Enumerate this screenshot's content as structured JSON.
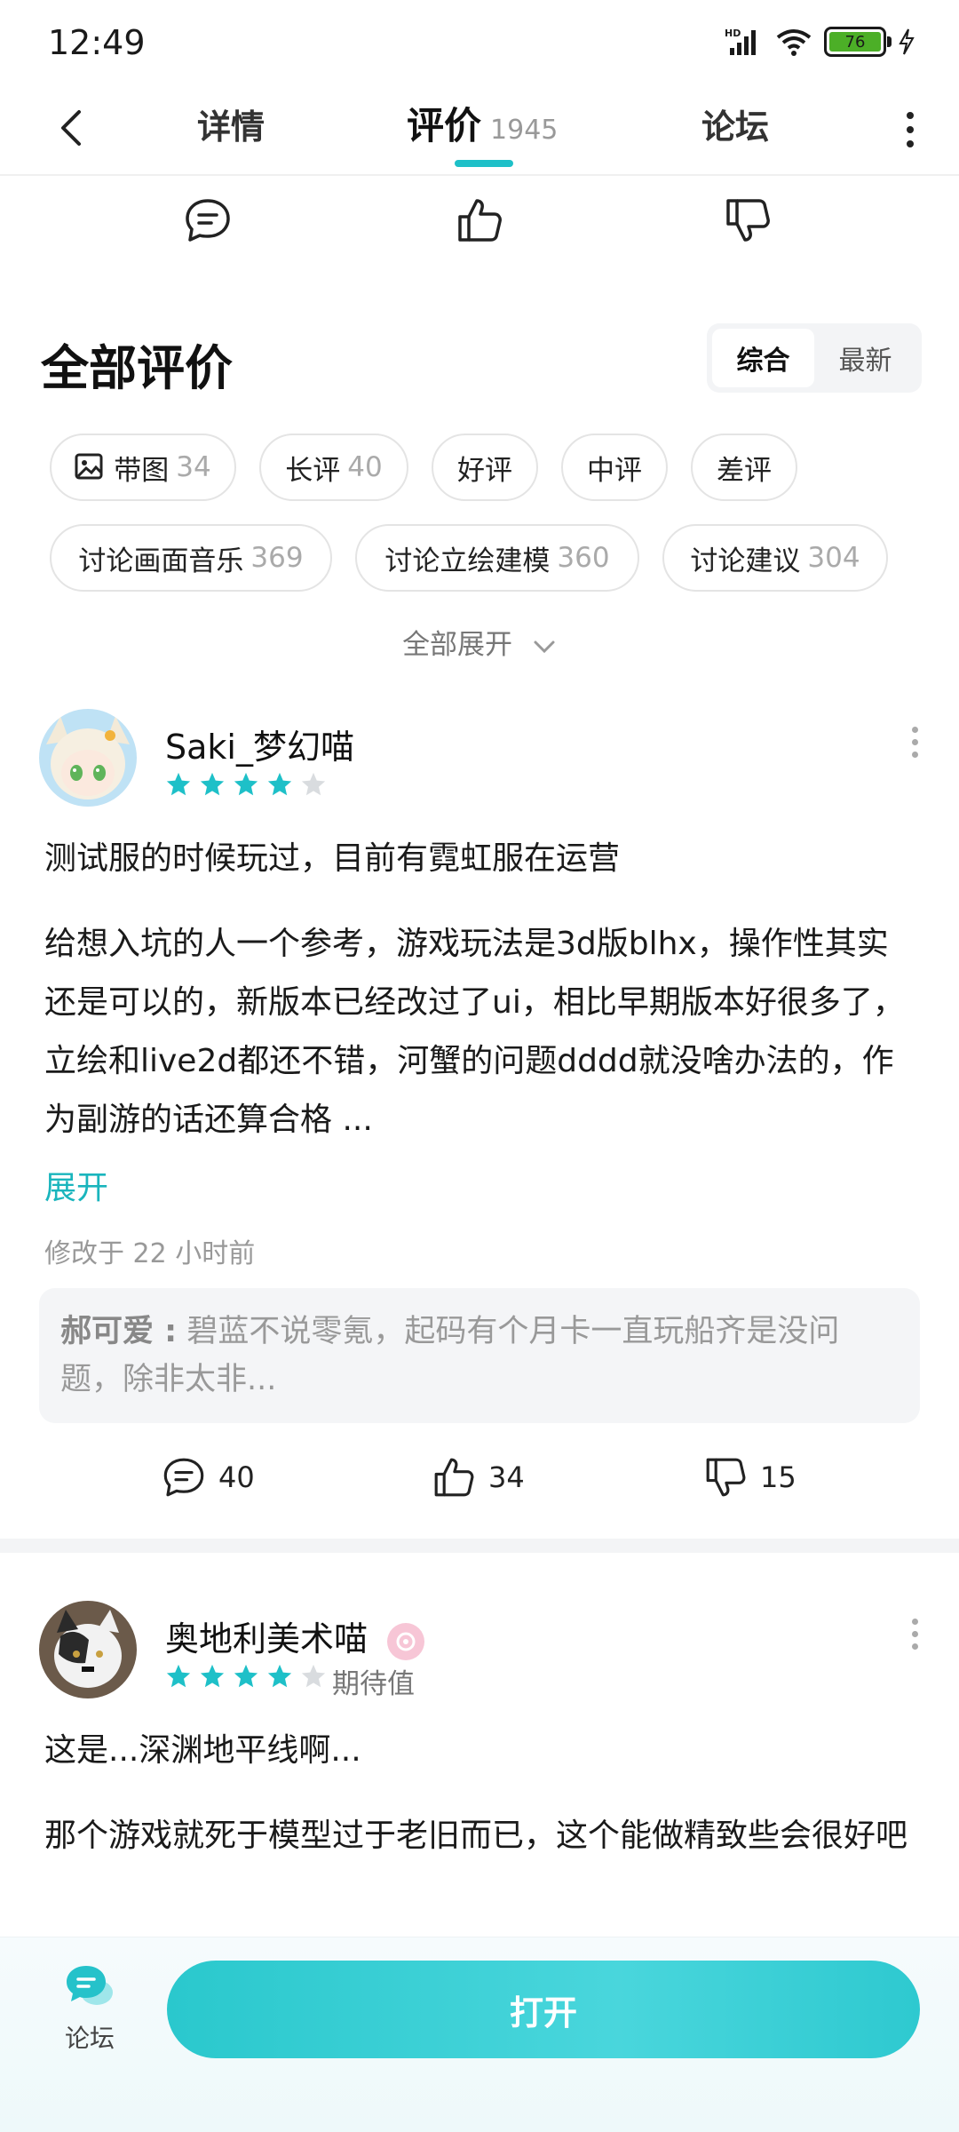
{
  "status_bar": {
    "time": "12:49",
    "battery": "76"
  },
  "nav": {
    "tabs": [
      {
        "label": "详情"
      },
      {
        "label": "评价",
        "count": "1945"
      },
      {
        "label": "论坛"
      }
    ]
  },
  "section": {
    "title": "全部评价",
    "sort": [
      "综合",
      "最新"
    ]
  },
  "filters": {
    "row1": [
      {
        "label": "带图",
        "count": "34"
      },
      {
        "label": "长评",
        "count": "40"
      },
      {
        "label": "好评",
        "count": ""
      },
      {
        "label": "中评",
        "count": ""
      },
      {
        "label": "差评",
        "count": ""
      }
    ],
    "row2": [
      {
        "label": "讨论画面音乐",
        "count": "369"
      },
      {
        "label": "讨论立绘建模",
        "count": "360"
      },
      {
        "label": "讨论建议",
        "count": "304"
      }
    ],
    "expand_all": "全部展开"
  },
  "reviews": [
    {
      "username": "Saki_梦幻喵",
      "rating": 4,
      "line1": "测试服的时候玩过，目前有霓虹服在运营",
      "body": "给想入坑的人一个参考，游戏玩法是3d版blhx，操作性其实还是可以的，新版本已经改过了ui，相比早期版本好很多了，立绘和live2d都还不错，河蟹的问题dddd就没啥办法的，作为副游的话还算合格 ...",
      "expand": "展开",
      "modified": "修改于 22 小时前",
      "reply_author": "郝可爱 :",
      "reply_text": "碧蓝不说零氪，起码有个月卡一直玩船齐是没问题，除非太非...",
      "comments": "40",
      "likes": "34",
      "dislikes": "15"
    },
    {
      "username": "奥地利美术喵",
      "rating": 4,
      "tag": "期待值",
      "line1": "这是...深渊地平线啊...",
      "body": "那个游戏就死于模型过于老旧而已，这个能做精致些会很好吧"
    }
  ],
  "bottom": {
    "forum_label": "论坛",
    "open_label": "打开"
  },
  "colors": {
    "accent": "#1ec0c8",
    "star": "#1ec0c8",
    "star_empty": "#d9dcdf"
  }
}
